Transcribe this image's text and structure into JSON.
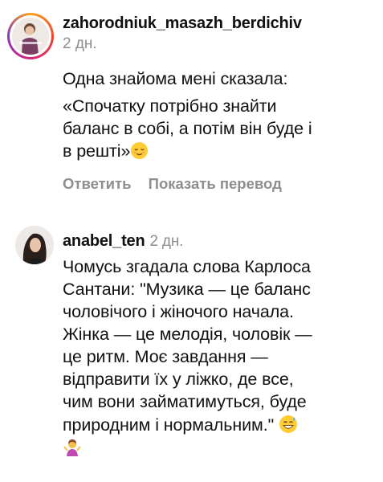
{
  "comments": [
    {
      "username": "zahorodniuk_masazh_berdichiv",
      "time": "2 дн.",
      "lines": [
        "Одна знайома мені сказала:",
        " «Спочатку потрібно знайти",
        "баланс в собі, а потім він буде і",
        "в решті»"
      ],
      "trailing_emoji": "relieved-face",
      "actions": {
        "reply": "Ответить",
        "translate": "Показать перевод"
      }
    },
    {
      "username": "anabel_ten",
      "time": "2 дн.",
      "lines": [
        "Чомусь згадала слова Карлоса",
        "Сантани: \"Музика — це баланс",
        "чоловічого і жіночого начала.",
        "Жінка — це мелодія, чоловік —",
        "це ритм. Моє  завдання —",
        "відправити їх у ліжко, де все,",
        "чим вони займатимуться, буде",
        "природним і нормальним.\""
      ],
      "trailing_emoji": "grinning-face-with-sweat",
      "final_line_emoji": "woman-shrugging"
    }
  ]
}
